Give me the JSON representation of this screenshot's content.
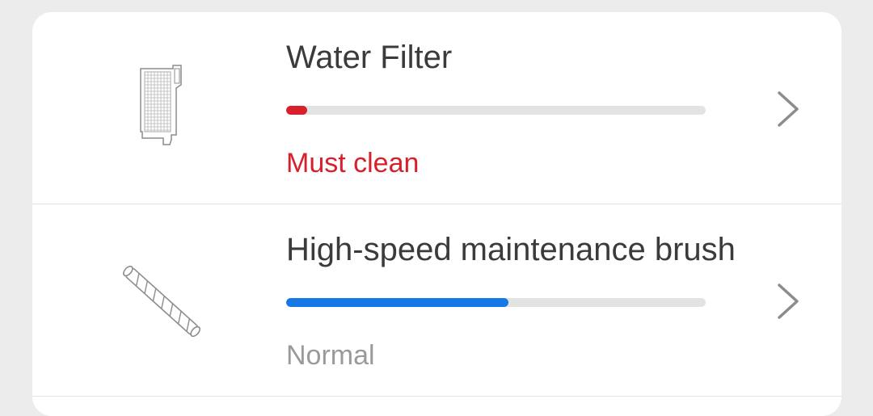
{
  "colors": {
    "must_clean": "#d8202a",
    "normal_progress": "#1677e6",
    "normal_status": "#9a9a9a"
  },
  "items": [
    {
      "title": "Water Filter",
      "status": "Must clean",
      "level": 0.05,
      "icon": "water-filter-icon"
    },
    {
      "title": "High-speed maintenance brush",
      "status": "Normal",
      "level": 0.53,
      "icon": "roller-brush-icon"
    }
  ]
}
